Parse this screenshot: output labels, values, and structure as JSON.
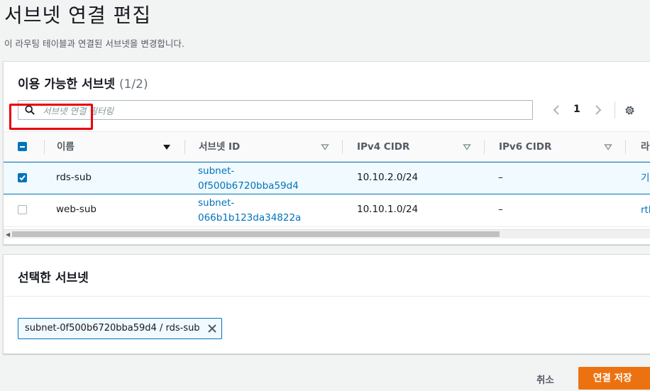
{
  "page": {
    "title": "서브넷 연결 편집",
    "description": "이 라우팅 테이블과 연결된 서브넷을 변경합니다."
  },
  "available": {
    "heading": "이용 가능한 서브넷",
    "count": "(1/2)",
    "filter_placeholder": "서브넷 연결 필터링",
    "page_number": "1",
    "columns": [
      "이름",
      "서브넷 ID",
      "IPv4 CIDR",
      "IPv6 CIDR",
      "라"
    ],
    "rows": [
      {
        "selected": true,
        "name": "rds-sub",
        "subnet_id_line1": "subnet-",
        "subnet_id_line2": "0f500b6720bba59d4",
        "ipv4": "10.10.2.0/24",
        "ipv6": "–",
        "route": "기"
      },
      {
        "selected": false,
        "name": "web-sub",
        "subnet_id_line1": "subnet-",
        "subnet_id_line2": "066b1b123da34822a",
        "ipv4": "10.10.1.0/24",
        "ipv6": "–",
        "route": "rtb"
      }
    ]
  },
  "selected": {
    "heading": "선택한 서브넷",
    "token": "subnet-0f500b6720bba59d4 / rds-sub"
  },
  "actions": {
    "cancel": "취소",
    "save": "연결 저장"
  },
  "colors": {
    "accent": "#0073bb",
    "primary_button": "#ec7211",
    "highlight": "#e8000b"
  }
}
